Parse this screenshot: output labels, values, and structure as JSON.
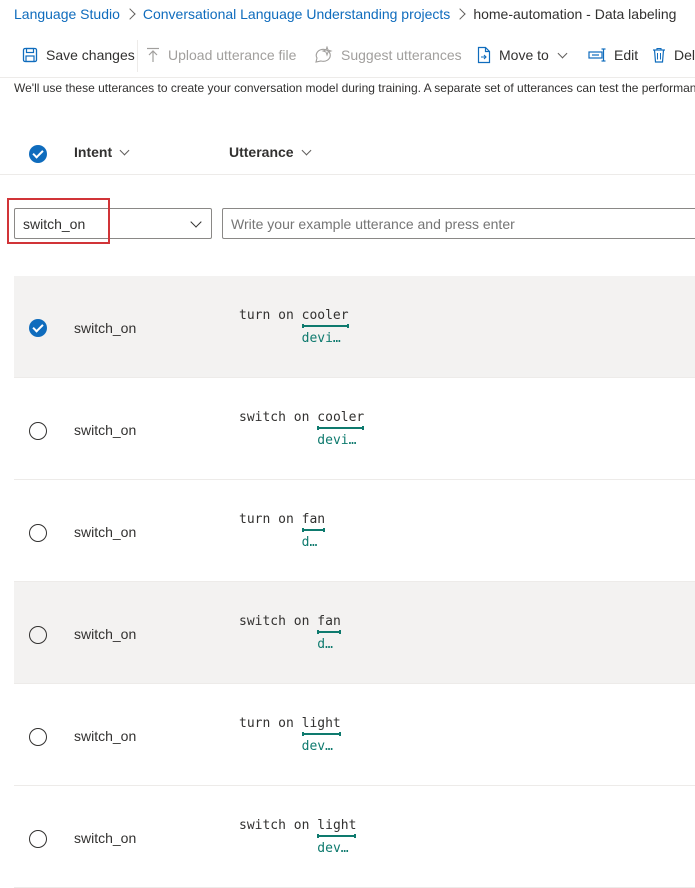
{
  "breadcrumb": {
    "root": "Language Studio",
    "projects": "Conversational Language Understanding projects",
    "current": "home-automation - Data labeling"
  },
  "toolbar": {
    "save": "Save changes",
    "upload": "Upload utterance file",
    "suggest": "Suggest utterances",
    "move_to": "Move to",
    "edit": "Edit",
    "delete": "Del"
  },
  "description": "We'll use these utterances to create your conversation model during training. A separate set of utterances can test the performan",
  "table": {
    "intent_header": "Intent",
    "utterance_header": "Utterance"
  },
  "new_utterance": {
    "intent_value": "switch_on",
    "placeholder": "Write your example utterance and press enter"
  },
  "rows": [
    {
      "intent": "switch_on",
      "prefix": "turn on ",
      "entity": "cooler",
      "entity_label": "devi…",
      "selected": true
    },
    {
      "intent": "switch_on",
      "prefix": "switch on ",
      "entity": "cooler",
      "entity_label": "devi…",
      "selected": false
    },
    {
      "intent": "switch_on",
      "prefix": "turn on ",
      "entity": "fan",
      "entity_label": "d…",
      "selected": false
    },
    {
      "intent": "switch_on",
      "prefix": "switch on ",
      "entity": "fan",
      "entity_label": "d…",
      "selected": false
    },
    {
      "intent": "switch_on",
      "prefix": "turn on ",
      "entity": "light",
      "entity_label": "dev…",
      "selected": false
    },
    {
      "intent": "switch_on",
      "prefix": "switch on ",
      "entity": "light",
      "entity_label": "dev…",
      "selected": false
    }
  ],
  "colors": {
    "link": "#0f6cbd",
    "entity": "#0e7a6e",
    "highlight": "#d13438",
    "row_selected": "#f3f2f1"
  }
}
